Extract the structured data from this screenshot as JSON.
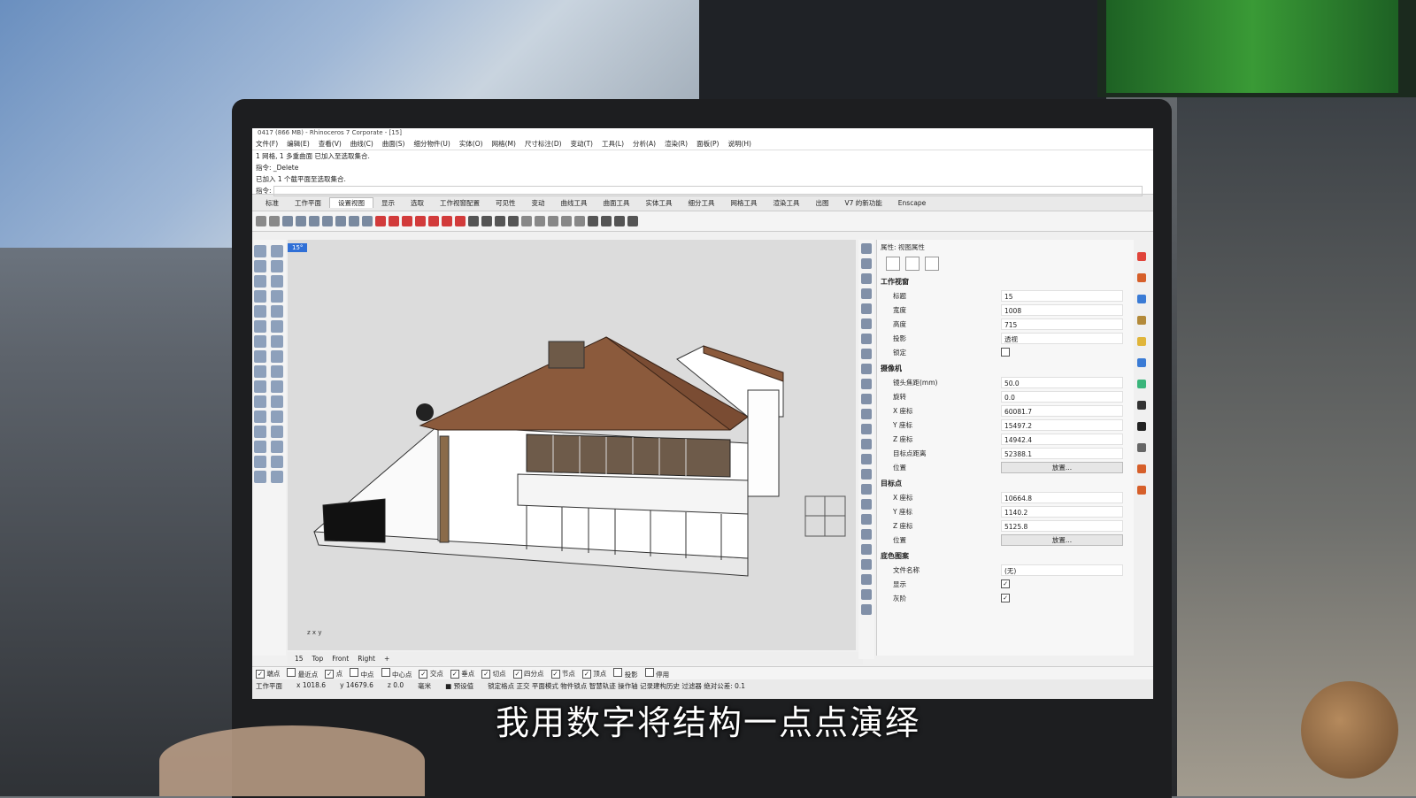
{
  "window": {
    "title": "0417 (866 MB) - Rhinoceros 7 Corporate - [15]"
  },
  "menu": [
    "文件(F)",
    "编辑(E)",
    "查看(V)",
    "曲线(C)",
    "曲面(S)",
    "细分物件(U)",
    "实体(O)",
    "网格(M)",
    "尺寸标注(D)",
    "变动(T)",
    "工具(L)",
    "分析(A)",
    "渲染(R)",
    "面板(P)",
    "说明(H)"
  ],
  "command": {
    "line1": "1 网格, 1 多重曲面 已加入至选取集合.",
    "line2": "指令: _Delete",
    "line3": "已加入 1 个截平面至选取集合.",
    "prompt": "指令:"
  },
  "tabs": [
    "标准",
    "工作平面",
    "设置视图",
    "显示",
    "选取",
    "工作视窗配置",
    "可见性",
    "变动",
    "曲线工具",
    "曲面工具",
    "实体工具",
    "细分工具",
    "网格工具",
    "渲染工具",
    "出图",
    "V7 的新功能",
    "Enscape"
  ],
  "active_tab": "设置视图",
  "viewport": {
    "label": "15°",
    "axis_x": "x",
    "axis_y": "y",
    "axis_z": "z"
  },
  "viewport_tabs": [
    "15",
    "Top",
    "Front",
    "Right"
  ],
  "panel": {
    "title": "属性: 视图属性",
    "section_viewport": "工作视窗",
    "fields_viewport": [
      {
        "k": "标题",
        "v": "15"
      },
      {
        "k": "宽度",
        "v": "1008"
      },
      {
        "k": "高度",
        "v": "715"
      },
      {
        "k": "投影",
        "v": "透视"
      },
      {
        "k": "锁定",
        "v": ""
      }
    ],
    "section_camera": "摄像机",
    "fields_camera": [
      {
        "k": "镜头焦距(mm)",
        "v": "50.0"
      },
      {
        "k": "旋转",
        "v": "0.0"
      },
      {
        "k": "X 座标",
        "v": "60081.7"
      },
      {
        "k": "Y 座标",
        "v": "15497.2"
      },
      {
        "k": "Z 座标",
        "v": "14942.4"
      },
      {
        "k": "目标点距离",
        "v": "52388.1"
      },
      {
        "k": "位置",
        "v": "放置..."
      }
    ],
    "section_target": "目标点",
    "fields_target": [
      {
        "k": "X 座标",
        "v": "10664.8"
      },
      {
        "k": "Y 座标",
        "v": "1140.2"
      },
      {
        "k": "Z 座标",
        "v": "5125.8"
      },
      {
        "k": "位置",
        "v": "放置..."
      }
    ],
    "section_wallpaper": "底色图案",
    "fields_wallpaper": [
      {
        "k": "文件名称",
        "v": "(无)"
      },
      {
        "k": "显示",
        "v": "✓"
      },
      {
        "k": "灰阶",
        "v": "✓"
      }
    ]
  },
  "osnap": [
    "端点",
    "最近点",
    "点",
    "中点",
    "中心点",
    "交点",
    "垂点",
    "切点",
    "四分点",
    "节点",
    "顶点",
    "投影",
    "停用"
  ],
  "status": {
    "cplane": "工作平面",
    "x": "x 1018.6",
    "y": "y 14679.6",
    "z": "z 0.0",
    "unit": "毫米",
    "layer": "■ 预设值",
    "modes": "锁定格点  正交  平面模式  物件锁点  智慧轨迹  操作轴  记录建构历史  过滤器  绝对公差: 0.1"
  },
  "subtitle": "我用数字将结构一点点演绎"
}
